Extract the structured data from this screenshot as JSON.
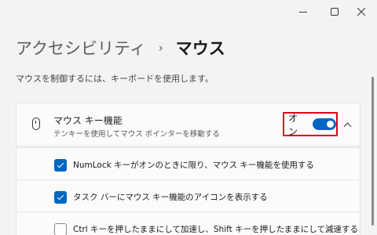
{
  "window": {
    "controls": {
      "minimize_icon": "minimize-icon",
      "maximize_icon": "maximize-icon",
      "close_icon": "close-icon"
    }
  },
  "breadcrumb": {
    "parent": "アクセシビリティ",
    "separator": "›",
    "current": "マウス"
  },
  "description": "マウスを制御するには、キーボードを使用します。",
  "mouse_keys": {
    "icon": "mouse-icon",
    "title": "マウス キー機能",
    "subtitle": "テンキーを使用してマウス ポインターを移動する",
    "toggle_label": "オン",
    "toggle_on": true,
    "highlight_color": "#e0001b",
    "accent_color": "#0067c0",
    "expanded": true
  },
  "options": [
    {
      "label": "NumLock キーがオンのときに限り、マウス キー機能を使用する",
      "checked": true
    },
    {
      "label": "タスク バーにマウス キー機能のアイコンを表示する",
      "checked": true
    },
    {
      "label": "Ctrl キーを押したままにして加速し、Shift キーを押したままにして減速する",
      "checked": false
    }
  ]
}
